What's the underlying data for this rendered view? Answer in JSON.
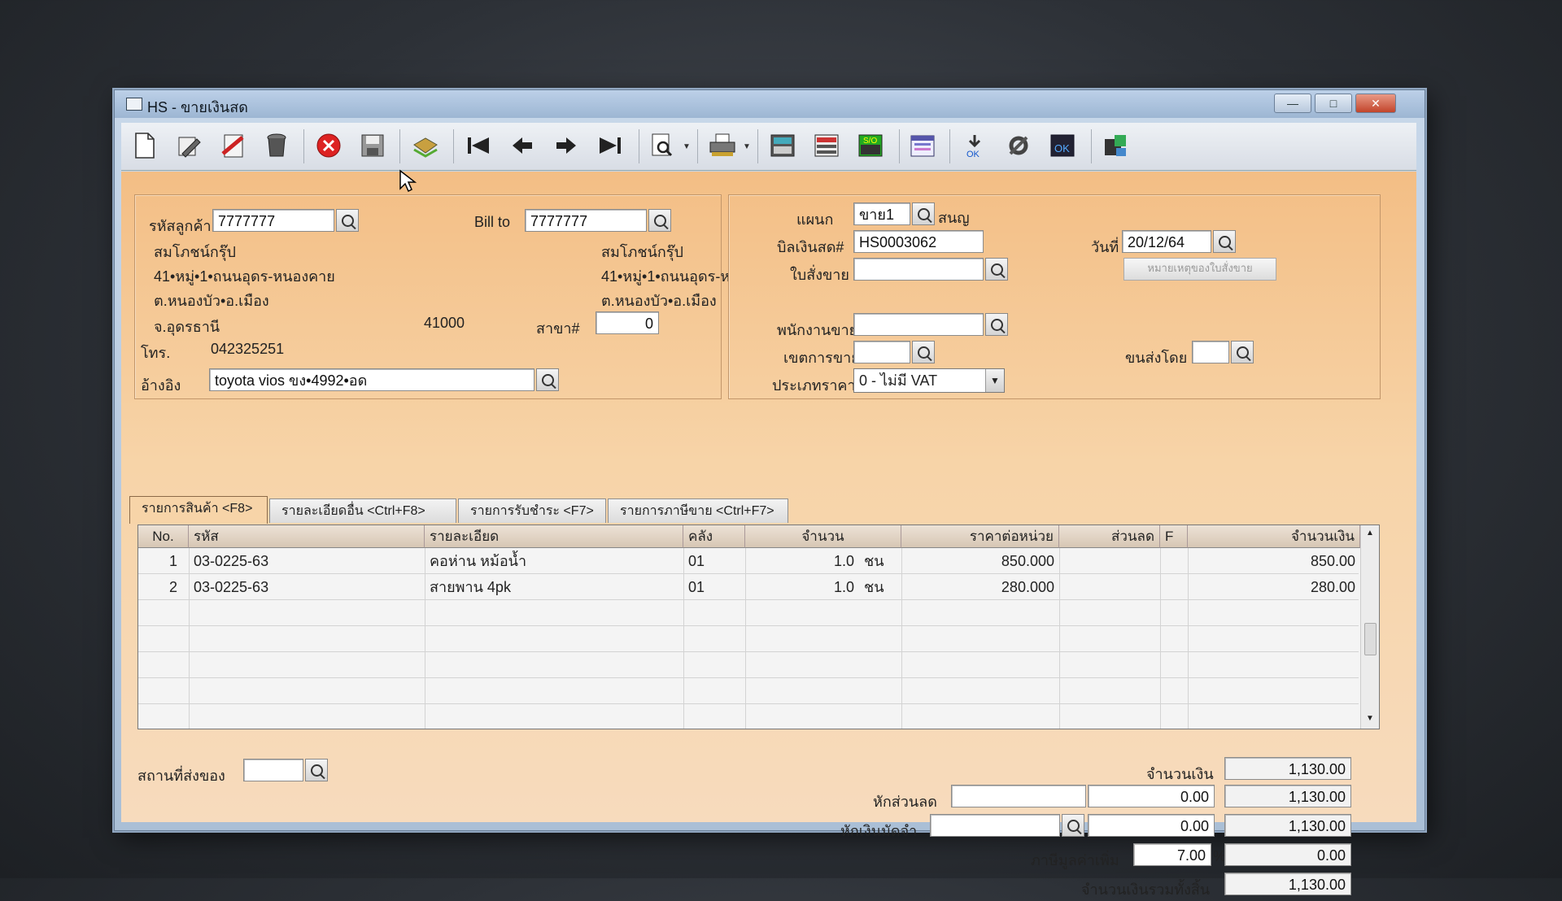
{
  "window": {
    "title": "HS - ขายเงินสด",
    "min": "—",
    "max": "□",
    "close": "✕"
  },
  "toolbar": {
    "icons": [
      "new-document-icon",
      "edit-icon",
      "cancel-doc-icon",
      "delete-bin-icon",
      "close-icon",
      "save-icon",
      "copy-icon",
      "first-record-icon",
      "previous-record-icon",
      "next-record-icon",
      "last-record-icon",
      "preview-icon",
      "print-icon",
      "calculator-icon",
      "report-icon",
      "sales-order-icon",
      "calendar-icon",
      "approve-icon",
      "tools-icon",
      "confirm-icon",
      "export-icon"
    ]
  },
  "customer": {
    "code_label": "รหัสลูกค้า",
    "code": "7777777",
    "billto_label": "Bill to",
    "billto": "7777777",
    "name": "สมโภชน์กรุ๊ป",
    "addr1": "41•หมู่•1•ถนนอุดร-หนองคาย",
    "addr2": "ต.หนองบัว•อ.เมือง",
    "addr3": "จ.อุดรธานี",
    "zip": "41000",
    "bill_name": "สมโภชน์กรุ๊ป",
    "bill_addr1": "41•หมู่•1•ถนนอุดร-ห",
    "bill_addr2": "ต.หนองบัว•อ.เมือง",
    "branch_label": "สาขา#",
    "branch": "0",
    "phone_label": "โทร.",
    "phone": "042325251",
    "ref_label": "อ้างอิง",
    "ref": "toyota vios ขง•4992•อด"
  },
  "doc": {
    "dept_label": "แผนก",
    "dept": "ขาย1",
    "dept_name": "สนญ",
    "bill_label": "บิลเงินสด#",
    "bill": "HS0003062",
    "date_label": "วันที่",
    "date": "20/12/64",
    "order_label": "ใบสั่งขาย",
    "order": "",
    "note_button": "หมายเหตุของใบสั่งขาย",
    "salesman_label": "พนักงานขาย",
    "salesman": "",
    "area_label": "เขตการขาย",
    "area": "",
    "ship_label": "ขนส่งโดย",
    "ship": "",
    "price_type_label": "ประเภทราคา",
    "price_type": "0 - ไม่มี VAT"
  },
  "tabs": [
    {
      "label": "รายการสินค้า <F8>"
    },
    {
      "label": "รายละเอียดอื่น <Ctrl+F8>"
    },
    {
      "label": "รายการรับชำระ <F7>"
    },
    {
      "label": "รายการภาษีขาย <Ctrl+F7>"
    }
  ],
  "grid": {
    "headers": [
      "No.",
      "รหัส",
      "รายละเอียด",
      "คลัง",
      "จำนวน",
      "ราคาต่อหน่วย",
      "ส่วนลด",
      "F",
      "จำนวนเงิน"
    ],
    "rows": [
      {
        "no": "1",
        "code": "03-0225-63",
        "desc": "คอห่าน หม้อน้ำ",
        "wh": "01",
        "qty": "1.0",
        "unit": "ชน",
        "price": "850.000",
        "disc": "",
        "f": "",
        "amount": "850.00"
      },
      {
        "no": "2",
        "code": "03-0225-63",
        "desc": "สายพาน 4pk",
        "wh": "01",
        "qty": "1.0",
        "unit": "ชน",
        "price": "280.000",
        "disc": "",
        "f": "",
        "amount": "280.00"
      }
    ]
  },
  "footer": {
    "delivery_label": "สถานที่ส่งของ",
    "delivery": "",
    "amount_label": "จำนวนเงิน",
    "amount": "1,130.00",
    "discount_label": "หักส่วนลด",
    "discount_text": "",
    "discount": "0.00",
    "discount_total": "1,130.00",
    "deposit_label": "หักเงินมัดจำ",
    "deposit_text": "",
    "deposit": "0.00",
    "deposit_total": "1,130.00",
    "vat_label": "ภาษีมูลค่าเพิ่ม",
    "vat_rate": "7.00",
    "vat_pct": "%",
    "vat_amount": "0.00",
    "grand_label": "จำนวนเงินรวมทั้งสิ้น",
    "grand_total": "1,130.00"
  }
}
